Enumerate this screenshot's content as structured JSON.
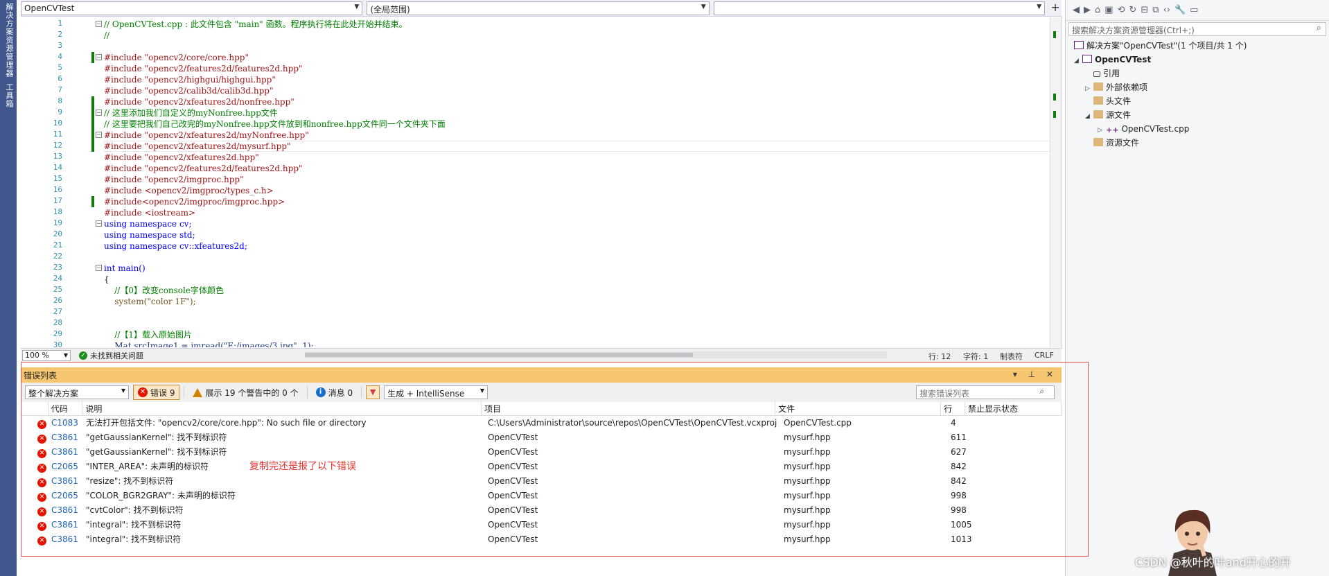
{
  "left_strip": {
    "tabs": [
      "解决方案资源管理器",
      "工具箱"
    ]
  },
  "editor": {
    "file_combo": "OpenCVTest",
    "scope_combo": "(全局范围)",
    "member_combo": "",
    "line_numbers": [
      "1",
      "2",
      "3",
      "4",
      "5",
      "6",
      "7",
      "8",
      "9",
      "10",
      "11",
      "12",
      "13",
      "14",
      "15",
      "16",
      "17",
      "18",
      "19",
      "20",
      "21",
      "22",
      "23",
      "24",
      "25",
      "26",
      "27",
      "28",
      "29",
      "30"
    ],
    "lines": [
      "// OpenCVTest.cpp : 此文件包含 \"main\" 函数。程序执行将在此处开始并结束。",
      "//",
      "",
      "#include \"opencv2/core/core.hpp\"",
      "#include \"opencv2/features2d/features2d.hpp\"",
      "#include \"opencv2/highgui/highgui.hpp\"",
      "#include \"opencv2/calib3d/calib3d.hpp\"",
      "#include \"opencv2/xfeatures2d/nonfree.hpp\"",
      "// 这里添加我们自定义的myNonfree.hpp文件",
      "// 这里要把我们自己改完的myNonfree.hpp文件放到和nonfree.hpp文件同一个文件夹下面",
      "#include \"opencv2/xfeatures2d/myNonfree.hpp\"",
      "#include \"opencv2/xfeatures2d/mysurf.hpp\"",
      "#include \"opencv2/xfeatures2d.hpp\"",
      "#include \"opencv2/features2d/features2d.hpp\"",
      "#include \"opencv2/imgproc.hpp\"",
      "#include <opencv2/imgproc/types_c.h>",
      "#include<opencv2/imgproc/imgproc.hpp>",
      "#include <iostream>",
      "using namespace cv;",
      "using namespace std;",
      "using namespace cv::xfeatures2d;",
      "",
      "int main()",
      "{",
      "    //【0】改变console字体颜色",
      "    system(\"color 1F\");",
      "",
      "",
      "    //【1】载入原始图片",
      "    Mat srcImage1 = imread(\"E:/images/3.jpg\", 1);"
    ],
    "zoom": "100 %",
    "issues_text": "未找到相关问题",
    "status_line": "行: 12",
    "status_char": "字符: 1",
    "status_tab": "制表符",
    "status_eol": "CRLF"
  },
  "solution_explorer": {
    "search_placeholder": "搜索解决方案资源管理器(Ctrl+;)",
    "solution_label": "解决方案\"OpenCVTest\"(1 个项目/共 1 个)",
    "project": "OpenCVTest",
    "items": {
      "refs": "引用",
      "external": "外部依赖项",
      "headers": "头文件",
      "sources": "源文件",
      "source_file": "OpenCVTest.cpp",
      "resources": "资源文件"
    }
  },
  "error_list": {
    "title": "错误列表",
    "scope": "整个解决方案",
    "errors_label": "错误 9",
    "warnings_label": "展示 19 个警告中的 0 个",
    "messages_label": "消息 0",
    "build_filter": "生成 + IntelliSense",
    "search_placeholder": "搜索错误列表",
    "columns": [
      "代码",
      "说明",
      "项目",
      "文件",
      "行",
      "禁止显示状态"
    ],
    "rows": [
      {
        "code": "C1083",
        "desc": "无法打开包括文件: \"opencv2/core/core.hpp\": No such file or directory",
        "project": "C:\\Users\\Administrator\\source\\repos\\OpenCVTest\\OpenCVTest.vcxproj",
        "file": "OpenCVTest.cpp",
        "line": "4"
      },
      {
        "code": "C3861",
        "desc": "\"getGaussianKernel\": 找不到标识符",
        "project": "OpenCVTest",
        "file": "mysurf.hpp",
        "line": "611"
      },
      {
        "code": "C3861",
        "desc": "\"getGaussianKernel\": 找不到标识符",
        "project": "OpenCVTest",
        "file": "mysurf.hpp",
        "line": "627"
      },
      {
        "code": "C2065",
        "desc": "\"INTER_AREA\": 未声明的标识符",
        "project": "OpenCVTest",
        "file": "mysurf.hpp",
        "line": "842"
      },
      {
        "code": "C3861",
        "desc": "\"resize\": 找不到标识符",
        "project": "OpenCVTest",
        "file": "mysurf.hpp",
        "line": "842"
      },
      {
        "code": "C2065",
        "desc": "\"COLOR_BGR2GRAY\": 未声明的标识符",
        "project": "OpenCVTest",
        "file": "mysurf.hpp",
        "line": "998"
      },
      {
        "code": "C3861",
        "desc": "\"cvtColor\": 找不到标识符",
        "project": "OpenCVTest",
        "file": "mysurf.hpp",
        "line": "998"
      },
      {
        "code": "C3861",
        "desc": "\"integral\": 找不到标识符",
        "project": "OpenCVTest",
        "file": "mysurf.hpp",
        "line": "1005"
      },
      {
        "code": "C3861",
        "desc": "\"integral\": 找不到标识符",
        "project": "OpenCVTest",
        "file": "mysurf.hpp",
        "line": "1013"
      }
    ]
  },
  "annotation": "复制完还是报了以下错误",
  "watermark": "CSDN @秋叶的叶and开心的开",
  "colors": {
    "error": "#e51400",
    "warning": "#d18100",
    "info": "#1a6dc9",
    "error_title_bar": "#f5c66f",
    "left_strip": "#40568d",
    "annotation": "#e8322c"
  }
}
